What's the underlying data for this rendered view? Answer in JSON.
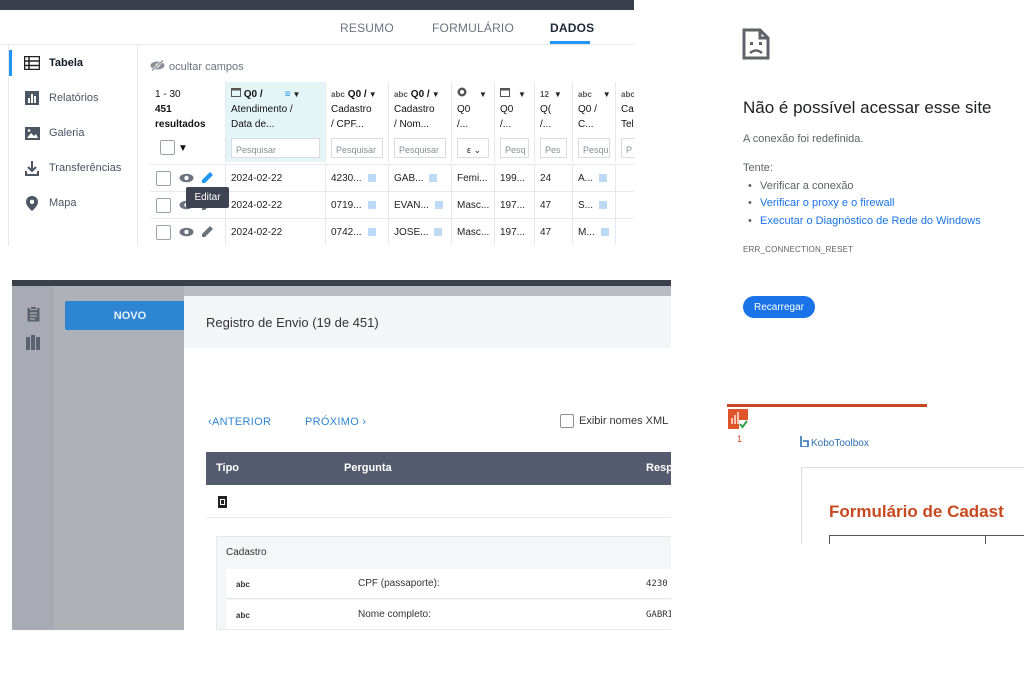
{
  "panel_data": {
    "tabs": [
      "RESUMO",
      "FORMULÁRIO",
      "DADOS"
    ],
    "active_tab": "DADOS",
    "sidebar": [
      {
        "label": "Tabela",
        "icon": "table-icon",
        "active": true
      },
      {
        "label": "Relatórios",
        "icon": "reports-icon",
        "active": false
      },
      {
        "label": "Galeria",
        "icon": "gallery-icon",
        "active": false
      },
      {
        "label": "Transferências",
        "icon": "download-icon",
        "active": false
      },
      {
        "label": "Mapa",
        "icon": "map-pin-icon",
        "active": false
      }
    ],
    "hide_fields": "ocultar campos",
    "range": "1 - 30",
    "results": "451 resultados",
    "columns": [
      {
        "type": "date-icon",
        "lines": [
          "Q0 /",
          "Atendimento /",
          "Data de..."
        ],
        "filter": "Pesquisar",
        "sorted": true
      },
      {
        "type": "abc",
        "lines": [
          "Q0 /",
          "Cadastro",
          "/ CPF..."
        ],
        "filter": "Pesquisar"
      },
      {
        "type": "abc",
        "lines": [
          "Q0 /",
          "Cadastro",
          "/ Nom..."
        ],
        "filter": "Pesquisar"
      },
      {
        "type": "radio-icon",
        "lines": [
          "",
          "Q0",
          "/..."
        ],
        "filter": "select"
      },
      {
        "type": "date-icon",
        "lines": [
          "",
          "Q0",
          "/..."
        ],
        "filter": "Pesq"
      },
      {
        "type": "12",
        "lines": [
          "",
          "Q(",
          "/..."
        ],
        "filter": "Pes"
      },
      {
        "type": "abc",
        "lines": [
          "",
          "Q0 /",
          "C..."
        ],
        "filter": "Pesqu"
      },
      {
        "type": "abc",
        "lines": [
          "",
          "Ca",
          "Tel"
        ],
        "filter": "P"
      }
    ],
    "rows": [
      [
        "2024-02-22",
        "4230...",
        "GAB...",
        "Femi...",
        "199...",
        "24",
        "A...",
        ""
      ],
      [
        "2024-02-22",
        "0719...",
        "EVAN...",
        "Masc...",
        "197...",
        "47",
        "S...",
        ""
      ],
      [
        "2024-02-22",
        "0742...",
        "JOSE...",
        "Masc...",
        "197...",
        "47",
        "M...",
        ""
      ]
    ],
    "tooltip": "Editar"
  },
  "error_page": {
    "title": "Não é possível acessar esse site",
    "subtitle": "A conexão foi redefinida.",
    "try_label": "Tente:",
    "suggestions": [
      {
        "text": "Verificar a conexão",
        "link": false
      },
      {
        "text": "Verificar o proxy e o firewall",
        "link": true
      },
      {
        "text": "Executar o Diagnóstico de Rede do Windows",
        "link": true
      }
    ],
    "code": "ERR_CONNECTION_RESET",
    "reload": "Recarregar"
  },
  "submission": {
    "new_button": "NOVO",
    "title": "Registro de Envio (19 de 451)",
    "prev": "ANTERIOR",
    "next": "PRÓXIMO",
    "xml_label": "Exibir nomes XML",
    "headers": [
      "Tipo",
      "Pergunta",
      "Resp"
    ],
    "group_label": "Cadastro",
    "rows": [
      {
        "type": "abc",
        "question": "CPF (passaporte):",
        "answer": "4230"
      },
      {
        "type": "abc",
        "question": "Nome completo:",
        "answer": "GABRI"
      }
    ]
  },
  "form_preview": {
    "tab_number": "1",
    "brand": "KoboToolbox",
    "form_title": "Formulário de Cadast"
  },
  "colors": {
    "accent": "#2095f3",
    "chrome_blue": "#1a73e8",
    "kobo_orange": "#c8481f"
  }
}
